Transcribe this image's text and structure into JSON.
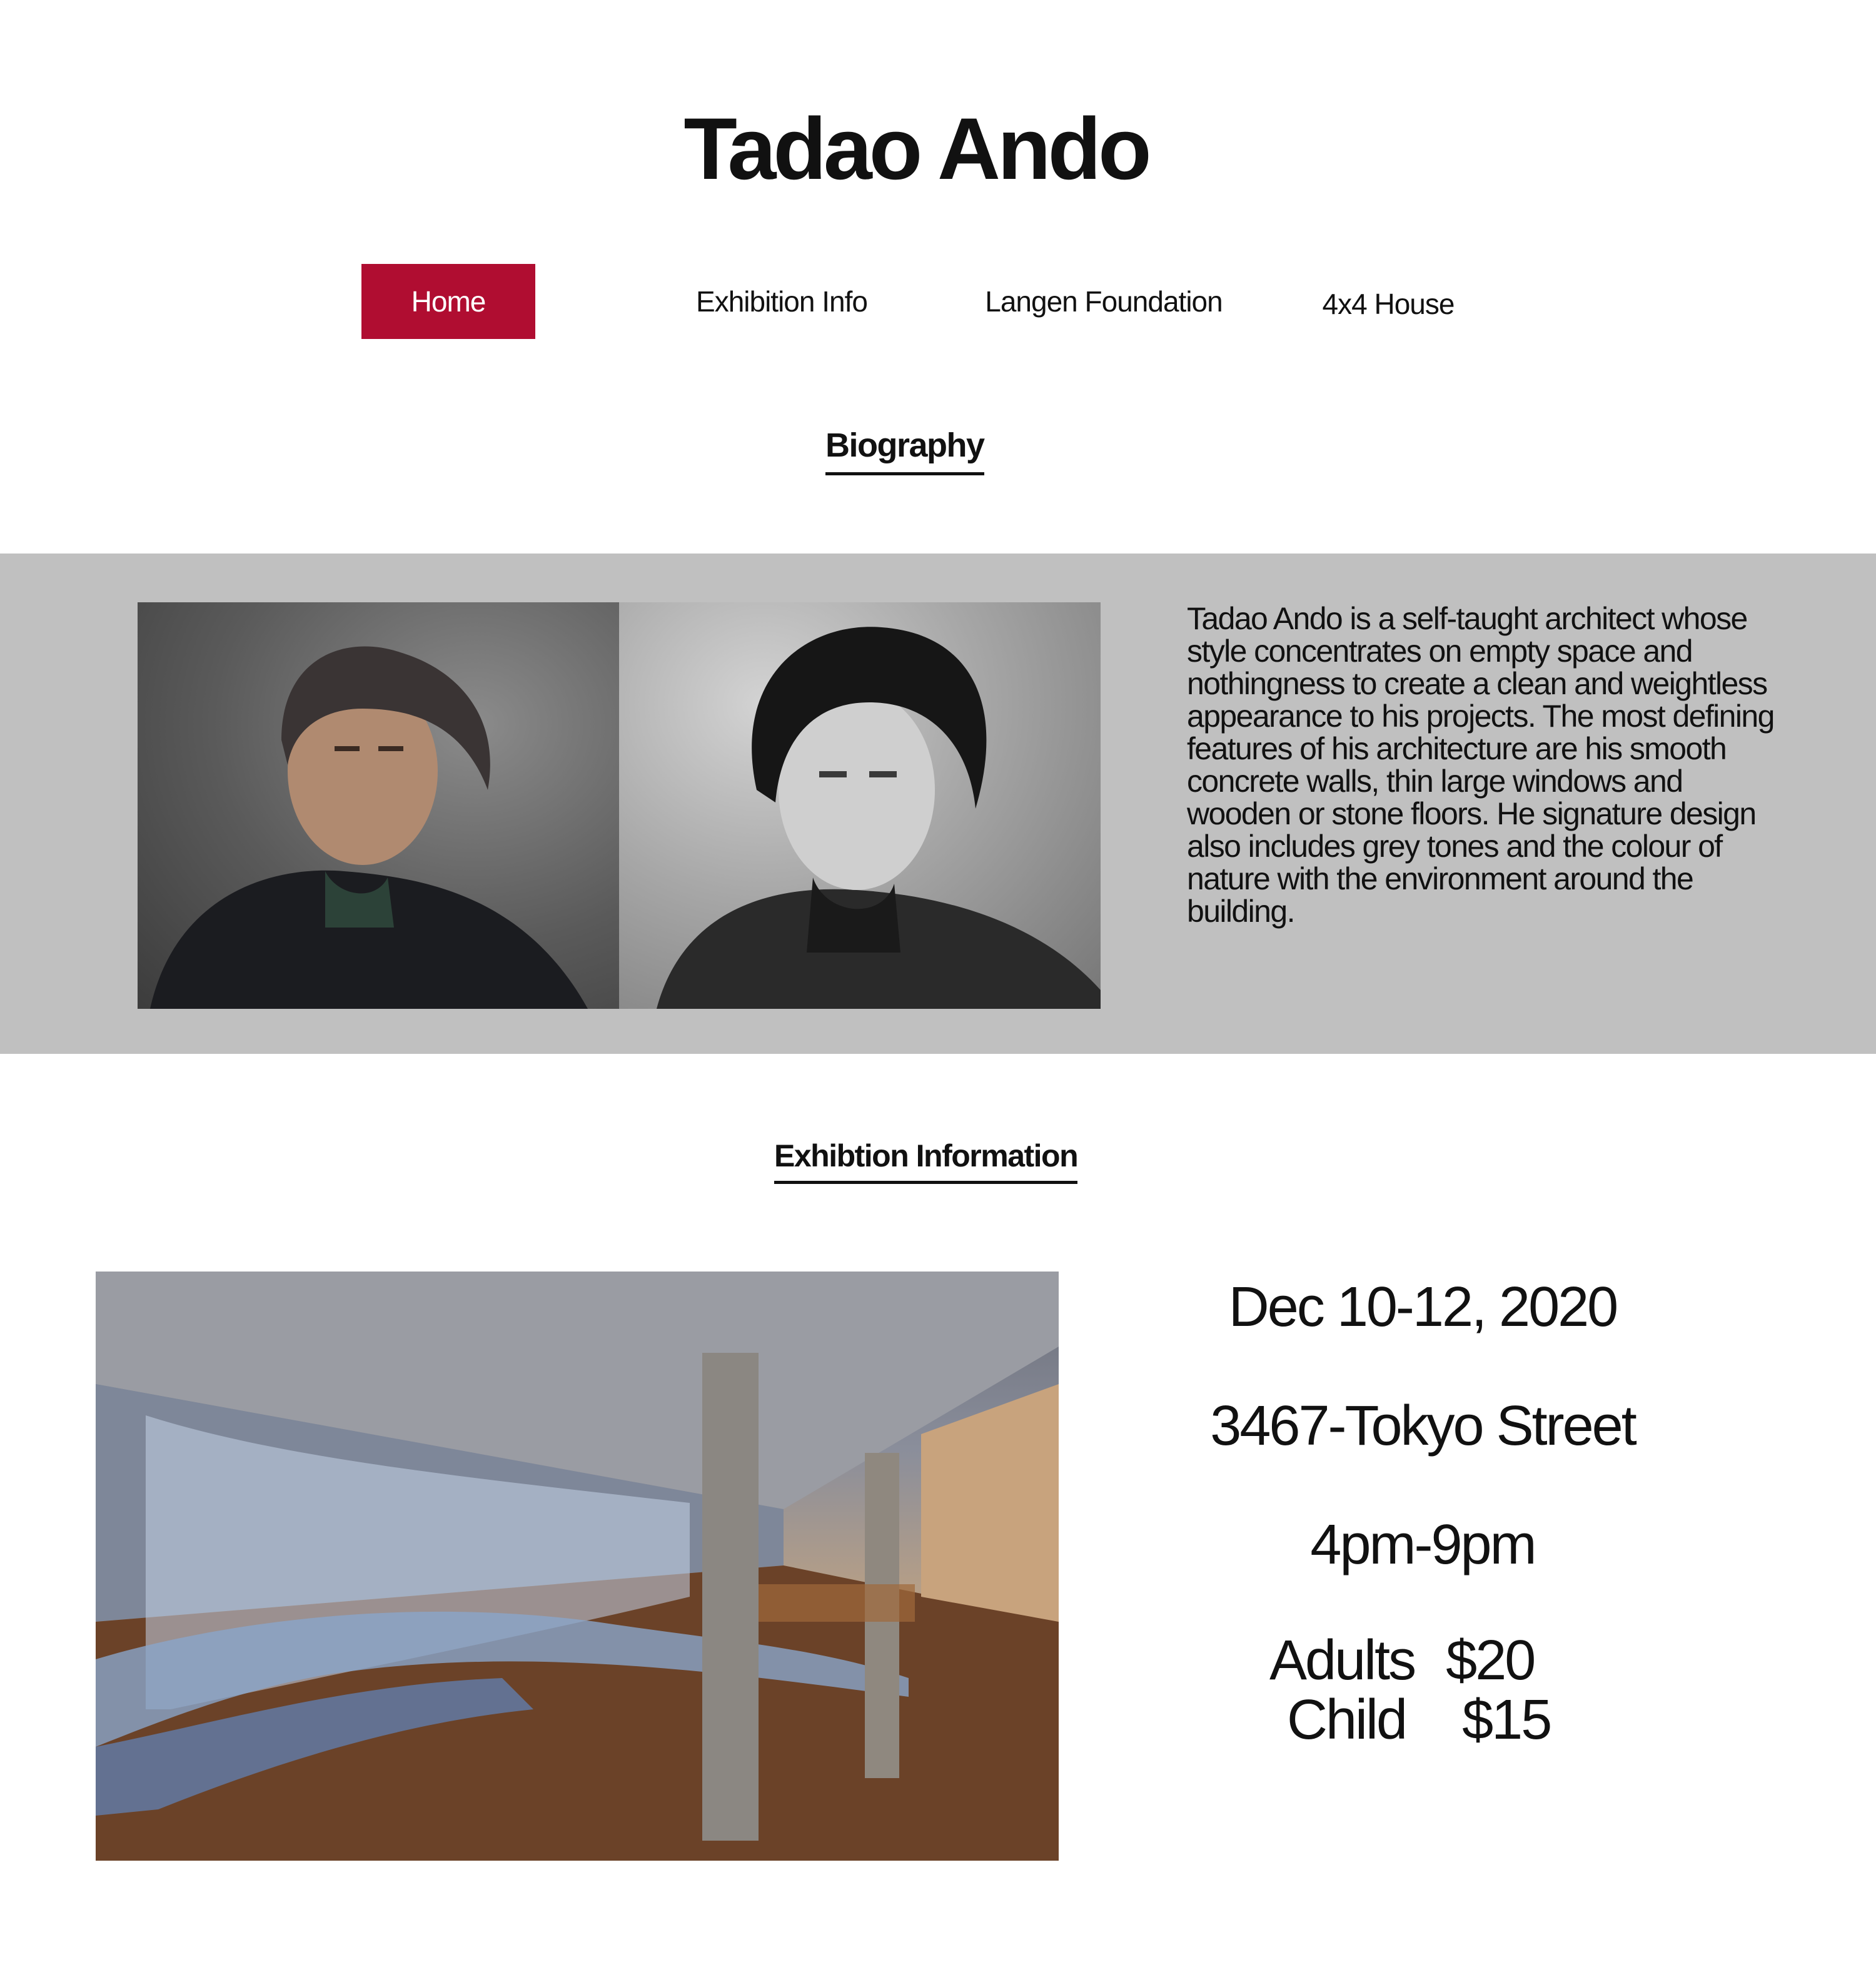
{
  "header": {
    "title": "Tadao Ando"
  },
  "nav": {
    "items": [
      {
        "label": "Home",
        "active": true
      },
      {
        "label": "Exhibition Info"
      },
      {
        "label": "Langen Foundation"
      },
      {
        "label": "4x4 House"
      }
    ]
  },
  "biography": {
    "heading": "Biography",
    "text": "Tadao Ando is a self-taught architect whose style concentrates on empty space and nothingness to create a clean and weightless appearance to his projects. The most defining features of his architecture are his smooth concrete walls, thin large windows and wooden or stone floors.  He signature design also includes grey tones and the colour of nature with the environment around the building."
  },
  "exhibition": {
    "heading": "Exhibtion Information",
    "date": "Dec 10-12, 2020",
    "address": "3467-Tokyo Street",
    "hours": "4pm-9pm",
    "prices": [
      {
        "label": "Adults",
        "price": "$20"
      },
      {
        "label": "Child",
        "price": "$15"
      }
    ]
  },
  "colors": {
    "accent": "#b00d31",
    "band": "#c0c0c0",
    "text": "#111111"
  }
}
